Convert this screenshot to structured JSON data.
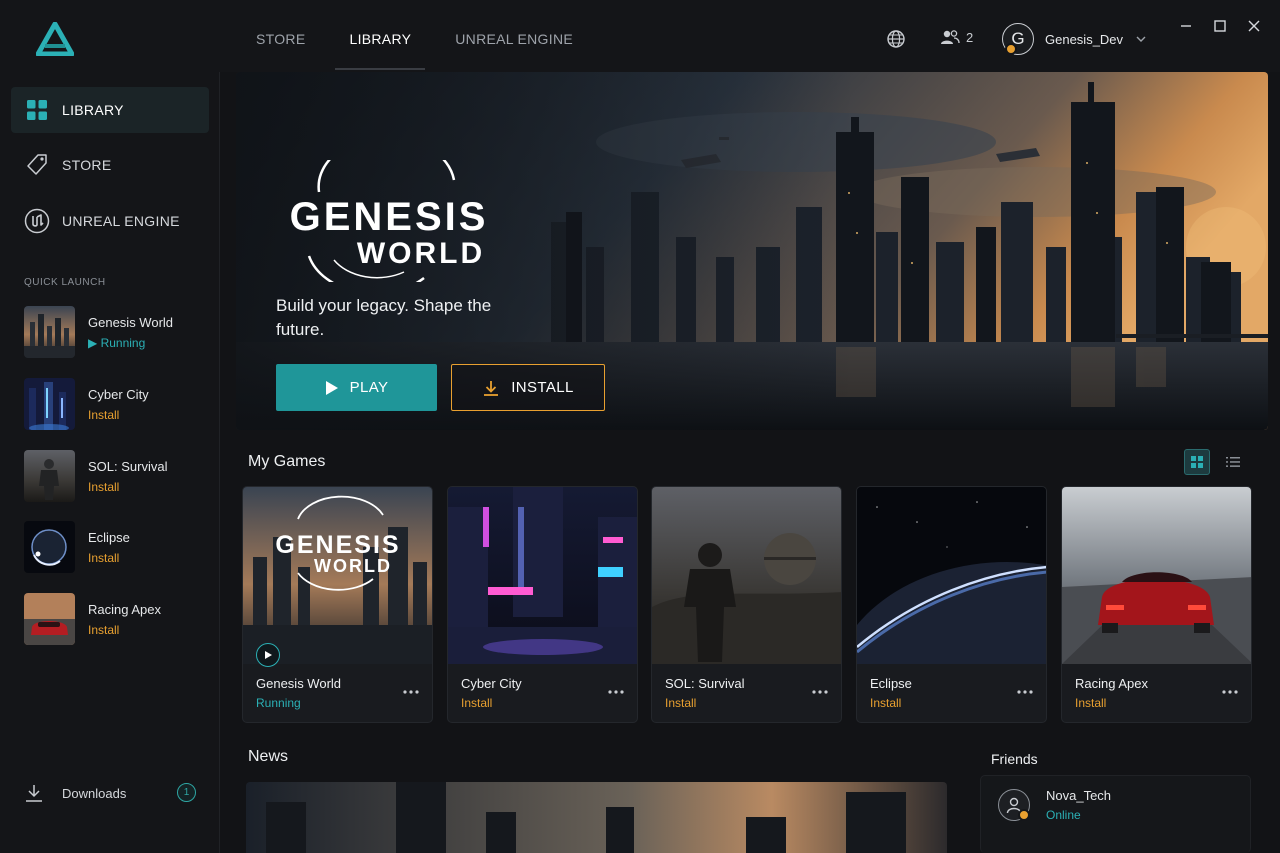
{
  "colors": {
    "accent": "#1f9699",
    "running": "#2bb0b5",
    "install": "#e8a030",
    "background": "#121316"
  },
  "topnav": {
    "tabs": [
      {
        "label": "STORE"
      },
      {
        "label": "LIBRARY",
        "active": true
      },
      {
        "label": "UNREAL ENGINE"
      }
    ]
  },
  "header": {
    "friends_count": "2",
    "user_initial": "G",
    "username": "Genesis_Dev"
  },
  "sidebar": {
    "nav": [
      {
        "label": "LIBRARY",
        "icon": "grid-icon",
        "active": true
      },
      {
        "label": "STORE",
        "icon": "tag-icon"
      },
      {
        "label": "UNREAL ENGINE",
        "icon": "unreal-logo-icon"
      }
    ],
    "quick_launch_title": "QUICK LAUNCH",
    "quick_launch": [
      {
        "name": "Genesis World",
        "status": "Running"
      },
      {
        "name": "Cyber City",
        "status": "Install"
      },
      {
        "name": "SOL: Survival",
        "status": "Install"
      },
      {
        "name": "Eclipse",
        "status": "Install"
      },
      {
        "name": "Racing Apex",
        "status": "Install"
      }
    ],
    "downloads_label": "Downloads",
    "downloads_count": "1"
  },
  "hero": {
    "title_line1": "GENESIS",
    "title_line2": "WORLD",
    "tagline": "Build your legacy. Shape the future.",
    "play_label": "PLAY",
    "install_label": "INSTALL"
  },
  "my_games": {
    "title": "My Games",
    "games": [
      {
        "name": "Genesis World",
        "status": "Running",
        "logo_line1": "GENESIS",
        "logo_line2": "WORLD"
      },
      {
        "name": "Cyber City",
        "status": "Install"
      },
      {
        "name": "SOL: Survival",
        "status": "Install"
      },
      {
        "name": "Eclipse",
        "status": "Install"
      },
      {
        "name": "Racing Apex",
        "status": "Install"
      }
    ]
  },
  "news": {
    "title": "News"
  },
  "friends": {
    "title": "Friends",
    "list": [
      {
        "name": "Nova_Tech",
        "status": "Online"
      }
    ]
  }
}
